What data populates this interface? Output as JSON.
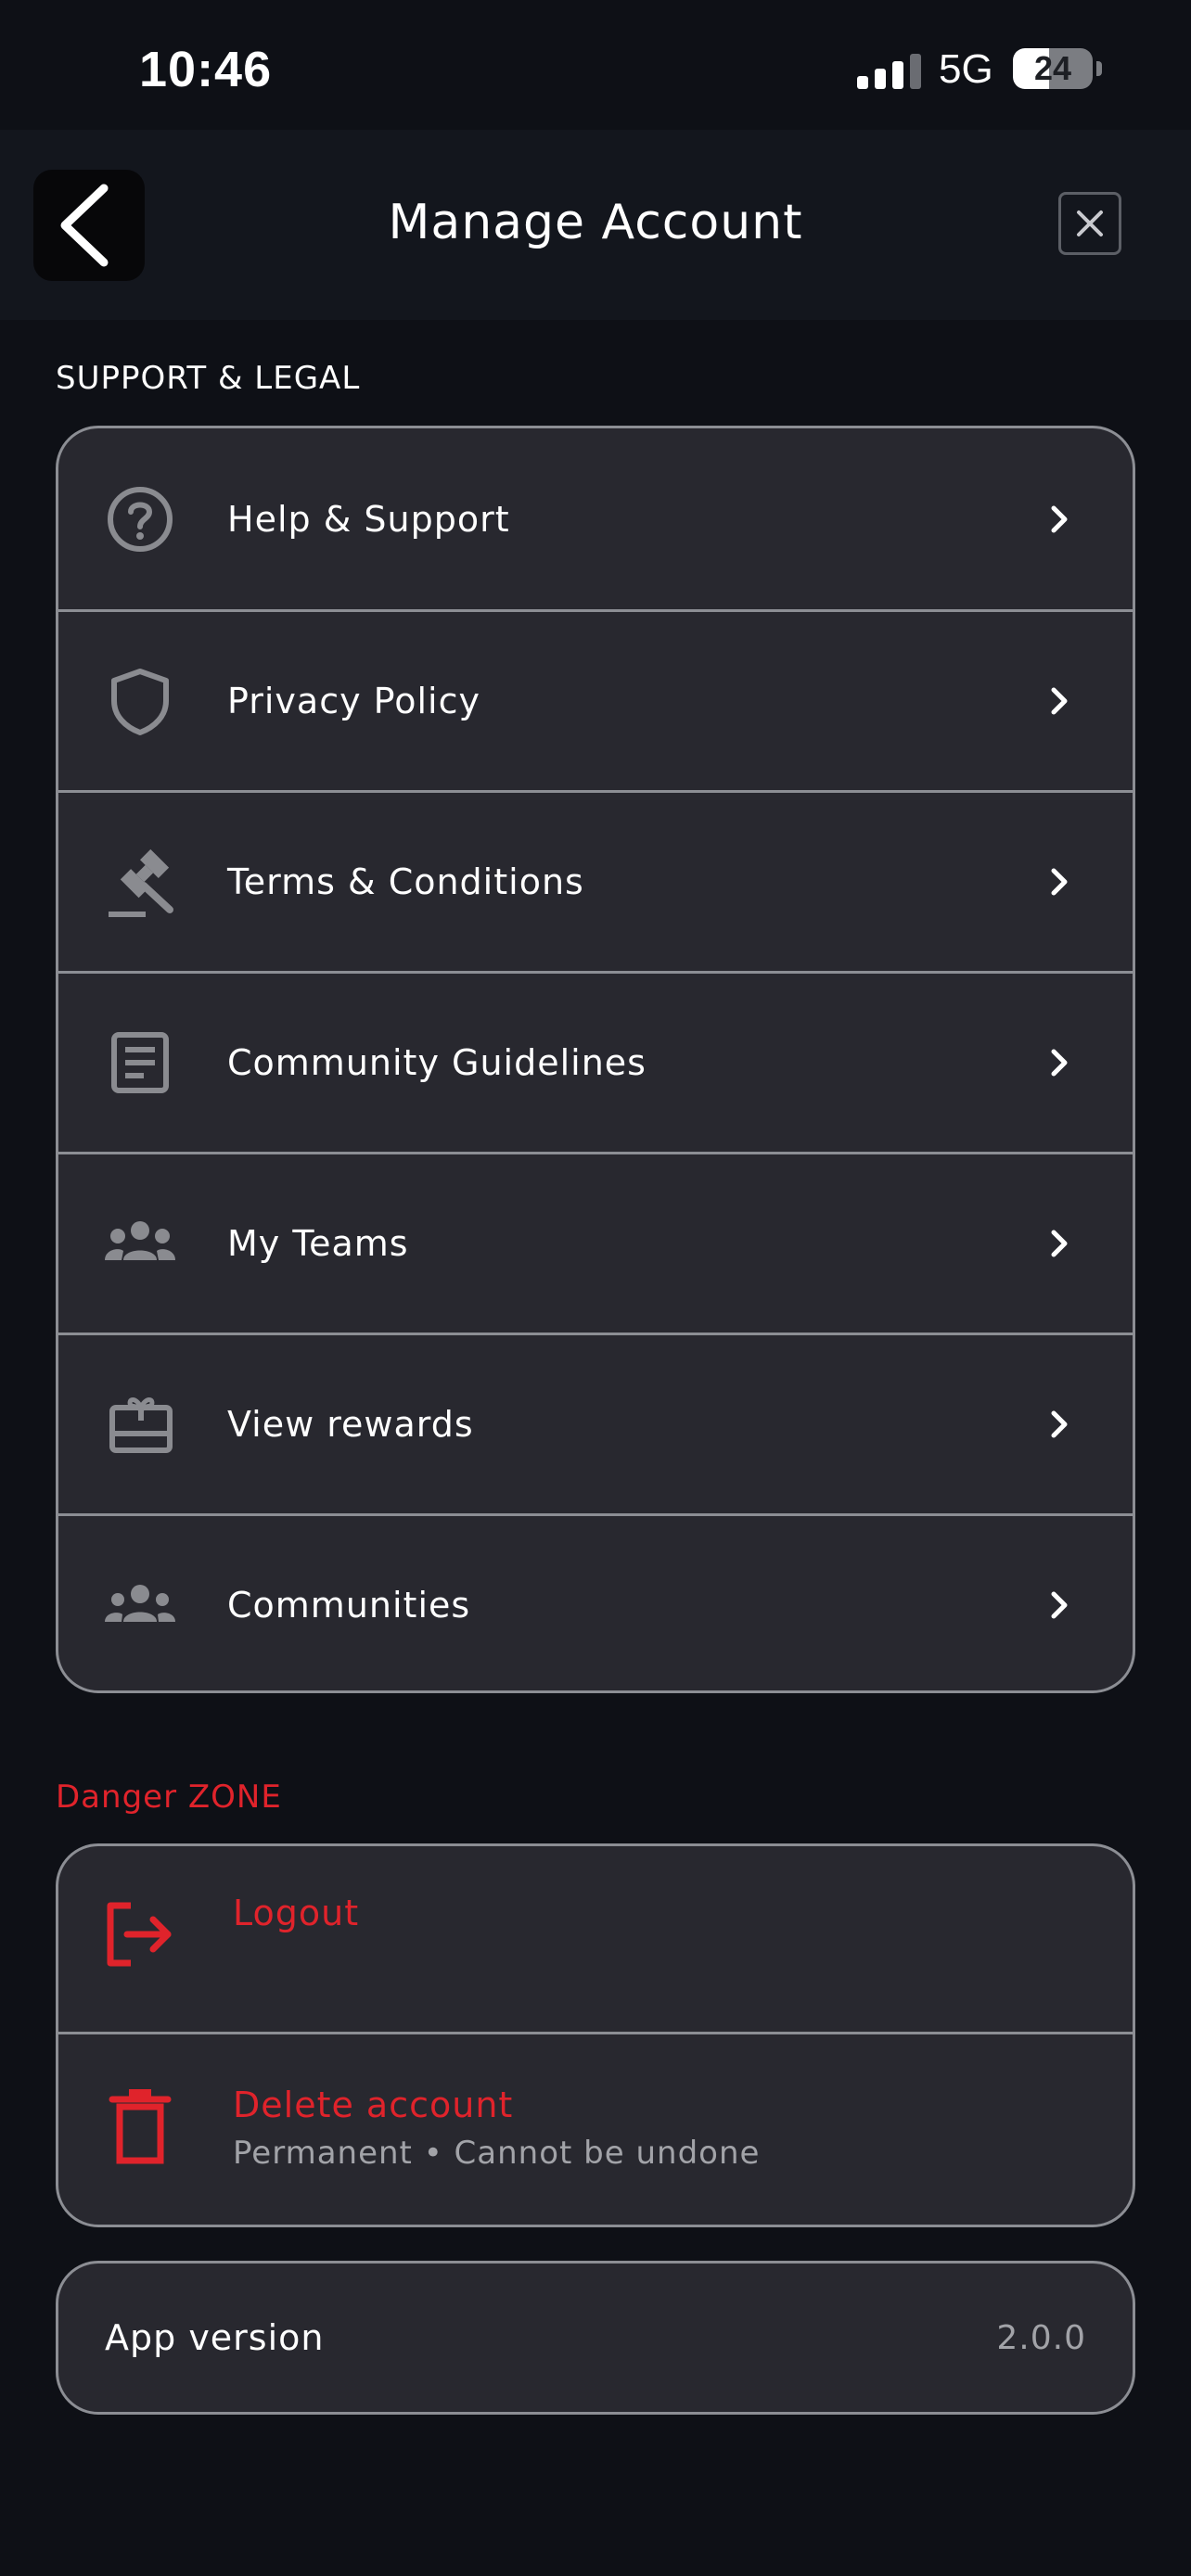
{
  "status_bar": {
    "time": "10:46",
    "network": "5G",
    "battery_percent": "24",
    "battery_level": 0.24,
    "signal_bars_active": 3
  },
  "header": {
    "title": "Manage Account",
    "back_icon": "chevron-left-icon",
    "close_icon": "close-icon"
  },
  "support_section": {
    "title": "SUPPORT & LEGAL",
    "items": [
      {
        "label": "Help & Support",
        "icon": "help-circle-icon"
      },
      {
        "label": "Privacy Policy",
        "icon": "shield-icon"
      },
      {
        "label": "Terms & Conditions",
        "icon": "gavel-icon"
      },
      {
        "label": "Community Guidelines",
        "icon": "document-icon"
      },
      {
        "label": "My Teams",
        "icon": "teams-icon"
      },
      {
        "label": "View rewards",
        "icon": "gift-card-icon"
      },
      {
        "label": "Communities",
        "icon": "communities-icon"
      }
    ]
  },
  "danger_section": {
    "title": "Danger ZONE",
    "logout": {
      "label": "Logout",
      "icon": "logout-icon"
    },
    "delete": {
      "label": "Delete account",
      "subtitle": "Permanent • Cannot be undone",
      "icon": "trash-icon"
    }
  },
  "app_version": {
    "label": "App version",
    "value": "2.0.0"
  },
  "colors": {
    "background": "#0e1016",
    "card": "#28282f",
    "border": "#8c8e94",
    "danger": "#e0232b",
    "icon_gray": "#8a8b90"
  }
}
